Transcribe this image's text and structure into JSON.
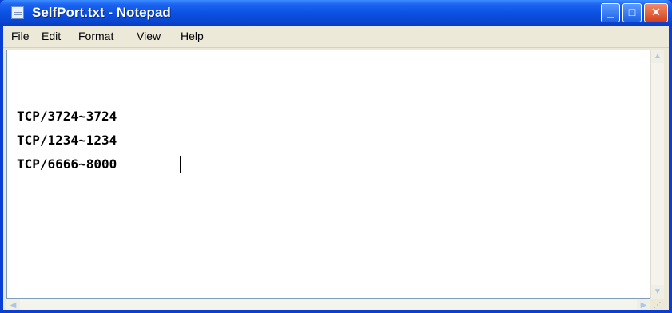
{
  "window": {
    "title": "SelfPort.txt - Notepad",
    "icon": "notepad-icon",
    "controls": {
      "minimize": "minimize-icon",
      "maximize": "maximize-icon",
      "close": "close-icon"
    }
  },
  "menu": {
    "file": "File",
    "edit": "Edit",
    "format": "Format",
    "view": "View",
    "help": "Help"
  },
  "document": {
    "lines": [
      "TCP/3724~3724",
      "TCP/1234~1234",
      "TCP/6666~8000"
    ]
  },
  "colors": {
    "titlebar": "#0a50e0",
    "close_button": "#d6401c",
    "chrome": "#ece9d8"
  }
}
